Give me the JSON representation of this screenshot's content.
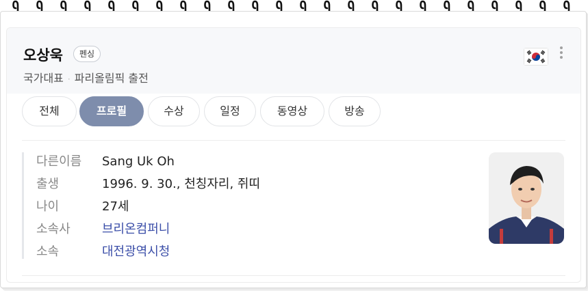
{
  "profile": {
    "name": "오상욱",
    "badge": "펜싱",
    "subtitle_part1": "국가대표",
    "subtitle_separator": "·",
    "subtitle_part2": "파리올림픽 출전",
    "flag_icon": "south-korea-flag-icon",
    "more_icon": "more-vertical-icon"
  },
  "tabs": [
    {
      "label": "전체",
      "active": false
    },
    {
      "label": "프로필",
      "active": true
    },
    {
      "label": "수상",
      "active": false
    },
    {
      "label": "일정",
      "active": false
    },
    {
      "label": "동영상",
      "active": false
    },
    {
      "label": "방송",
      "active": false
    }
  ],
  "info": [
    {
      "label": "다른이름",
      "value": "Sang Uk Oh"
    },
    {
      "label": "출생",
      "value": "1996. 9. 30., 천칭자리, 쥐띠"
    },
    {
      "label": "나이",
      "value": "27세"
    },
    {
      "label": "소속사",
      "value": "브리온컴퍼니"
    },
    {
      "label": "소속",
      "value": "대전광역시청"
    }
  ],
  "colors": {
    "active_tab": "#7e8dac",
    "link": "#3b4ea8",
    "header_bg": "#f7f8fa"
  }
}
